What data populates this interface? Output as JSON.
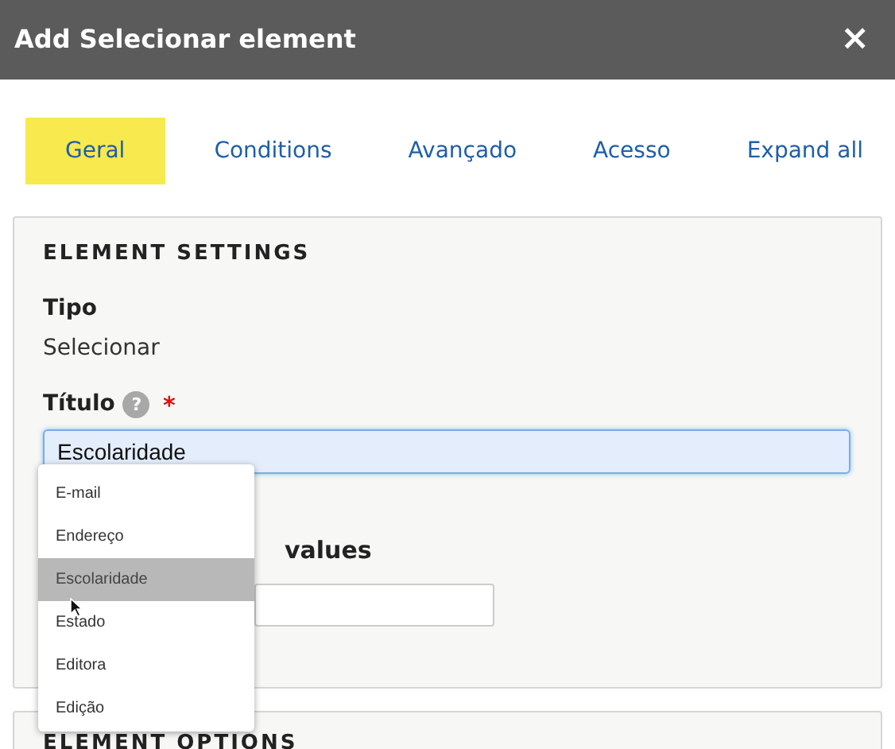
{
  "window": {
    "title": "Add Selecionar element",
    "close": "×"
  },
  "tabs": [
    {
      "label": "Geral",
      "selected": true
    },
    {
      "label": "Conditions",
      "selected": false
    },
    {
      "label": "Avançado",
      "selected": false
    },
    {
      "label": "Acesso",
      "selected": false
    }
  ],
  "expand_all": "Expand all",
  "element_settings": {
    "heading": "ELEMENT SETTINGS",
    "tipo_label": "Tipo",
    "tipo_value": "Selecionar",
    "titulo_label": "Título",
    "help": "?",
    "required_mark": "*",
    "titulo_value": "Escolaridade",
    "values_label": "values"
  },
  "dropdown": [
    {
      "label": "E-mail",
      "selected": false
    },
    {
      "label": "Endereço",
      "selected": false
    },
    {
      "label": "Escolaridade",
      "selected": true
    },
    {
      "label": "Estado",
      "selected": false
    },
    {
      "label": "Editora",
      "selected": false
    },
    {
      "label": "Edição",
      "selected": false
    }
  ],
  "element_options": {
    "heading": "ELEMENT OPTIONS"
  }
}
